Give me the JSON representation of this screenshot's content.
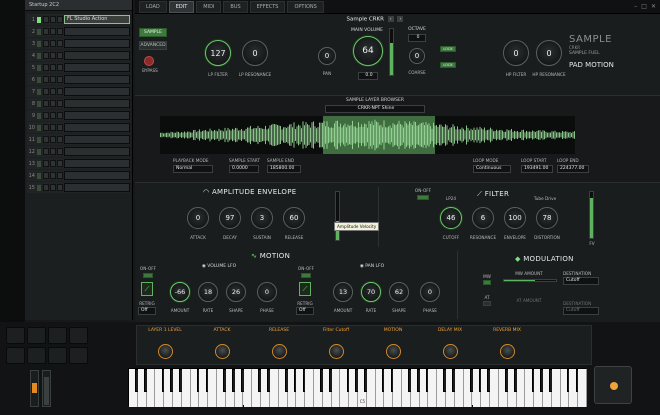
{
  "rack": {
    "title": "Startup 2C2",
    "rows": [
      {
        "num": "1",
        "name": "FL Studio Action",
        "active": true
      },
      {
        "num": "2",
        "name": "",
        "active": false
      },
      {
        "num": "3",
        "name": "",
        "active": false
      },
      {
        "num": "4",
        "name": "",
        "active": false
      },
      {
        "num": "5",
        "name": "",
        "active": false
      },
      {
        "num": "6",
        "name": "",
        "active": false
      },
      {
        "num": "7",
        "name": "",
        "active": false
      },
      {
        "num": "8",
        "name": "",
        "active": false
      },
      {
        "num": "9",
        "name": "",
        "active": false
      },
      {
        "num": "10",
        "name": "",
        "active": false
      },
      {
        "num": "11",
        "name": "",
        "active": false
      },
      {
        "num": "12",
        "name": "",
        "active": false
      },
      {
        "num": "13",
        "name": "",
        "active": false
      },
      {
        "num": "14",
        "name": "",
        "active": false
      },
      {
        "num": "15",
        "name": "",
        "active": false
      }
    ]
  },
  "tabs": [
    "LOAD",
    "EDIT",
    "MIDI",
    "BUS",
    "EFFECTS",
    "OPTIONS"
  ],
  "active_tab": "EDIT",
  "preset": {
    "title": "Sample CRKR"
  },
  "top": {
    "sample_btn": "SAMPLE",
    "advanced_btn": "ADVANCED",
    "bypass": "BYPASS",
    "lp_filter": {
      "value": "127",
      "label": "LP FILTER"
    },
    "lp_resonance": {
      "value": "0",
      "label": "LP RESONANCE"
    },
    "pan": {
      "value": "0",
      "label": "PAN"
    },
    "main_volume": {
      "value": "64",
      "label": "MAIN VOLUME",
      "readout": "0.0"
    },
    "octave": {
      "label": "OCTAVE",
      "value": "0"
    },
    "coarse": {
      "value": "0",
      "label": "COARSE"
    },
    "lock_a": "LOCK",
    "lock_b": "LOCK",
    "hp_filter": {
      "value": "0",
      "label": "HP FILTER"
    },
    "hp_resonance": {
      "value": "0",
      "label": "HP RESONANCE"
    },
    "brand": "SAMPLE",
    "brand_sub": "CRKR",
    "brand_line": "SAMPLE FUEL",
    "pad_motion": "PAD MOTION"
  },
  "waveform": {
    "section_label": "SAMPLE LAYER BROWSER",
    "sample_name": "CRKR-NPT Shine",
    "playback_mode_label": "PLAYBACK MODE",
    "playback_mode": "Normal",
    "sample_start_label": "SAMPLE START",
    "sample_start": "0.0000",
    "sample_end_label": "SAMPLE END",
    "sample_end": "185800.00",
    "loop_mode_label": "LOOP MODE",
    "loop_mode": "Continuous",
    "loop_start_label": "LOOP START",
    "loop_start": "193491.00",
    "loop_end_label": "LOOP END",
    "loop_end": "224377.00"
  },
  "envelope": {
    "title": "AMPLITUDE ENVELOPE",
    "attack": {
      "value": "0",
      "label": "ATTACK"
    },
    "decay": {
      "value": "97",
      "label": "DECAY"
    },
    "sustain": {
      "value": "3",
      "label": "SUSTAIN"
    },
    "release": {
      "value": "60",
      "label": "RELEASE"
    },
    "velocity_tooltip": "Amplitude Velocity"
  },
  "filter": {
    "title": "FILTER",
    "on_off": "ON-OFF",
    "type_label": "LP24",
    "cutoff": {
      "value": "46",
      "label": "CUTOFF"
    },
    "resonance": {
      "value": "6",
      "label": "RESONANCE"
    },
    "envelope": {
      "value": "100",
      "label": "ENVELOPE"
    },
    "distortion": {
      "value": "78",
      "label": "DISTORTION",
      "mode": "Tube Drive"
    },
    "fv": "FV"
  },
  "motion": {
    "title": "MOTION",
    "volume_lfo": {
      "title": "VOLUME LFO",
      "on_off": "ON-OFF",
      "retrig_label": "RETRIG",
      "retrig": "Off",
      "amount": {
        "value": "-66",
        "label": "AMOUNT"
      },
      "rate": {
        "value": "18",
        "label": "RATE"
      },
      "shape": {
        "value": "26",
        "label": "SHAPE"
      },
      "phase": {
        "value": "0",
        "label": "PHASE"
      }
    },
    "pan_lfo": {
      "title": "PAN LFO",
      "on_off": "ON-OFF",
      "retrig_label": "RETRIG",
      "retrig": "Off",
      "amount": {
        "value": "13",
        "label": "AMOUNT"
      },
      "rate": {
        "value": "70",
        "label": "RATE"
      },
      "shape": {
        "value": "62",
        "label": "SHAPE"
      },
      "phase": {
        "value": "0",
        "label": "PHASE"
      }
    }
  },
  "modulation": {
    "title": "MODULATION",
    "mw_label": "MW",
    "mw_amount_label": "MW AMOUNT",
    "destination_label": "DESTINATION",
    "destination": "Cutoff",
    "at_label": "AT",
    "at_amount_label": "AT AMOUNT",
    "at_destination_label": "DESTINATION",
    "at_destination": "Cutoff"
  },
  "macros": [
    "LAYER 1 LEVEL",
    "ATTACK",
    "RELEASE",
    "Filter Cutoff",
    "MOTION",
    "DELAY MIX",
    "REVERB MIX"
  ],
  "keyboard": {
    "c_label": "C5"
  },
  "colors": {
    "accent_green": "#5fb35f",
    "accent_orange": "#f0a33a",
    "panel": "#1a1d1e"
  }
}
